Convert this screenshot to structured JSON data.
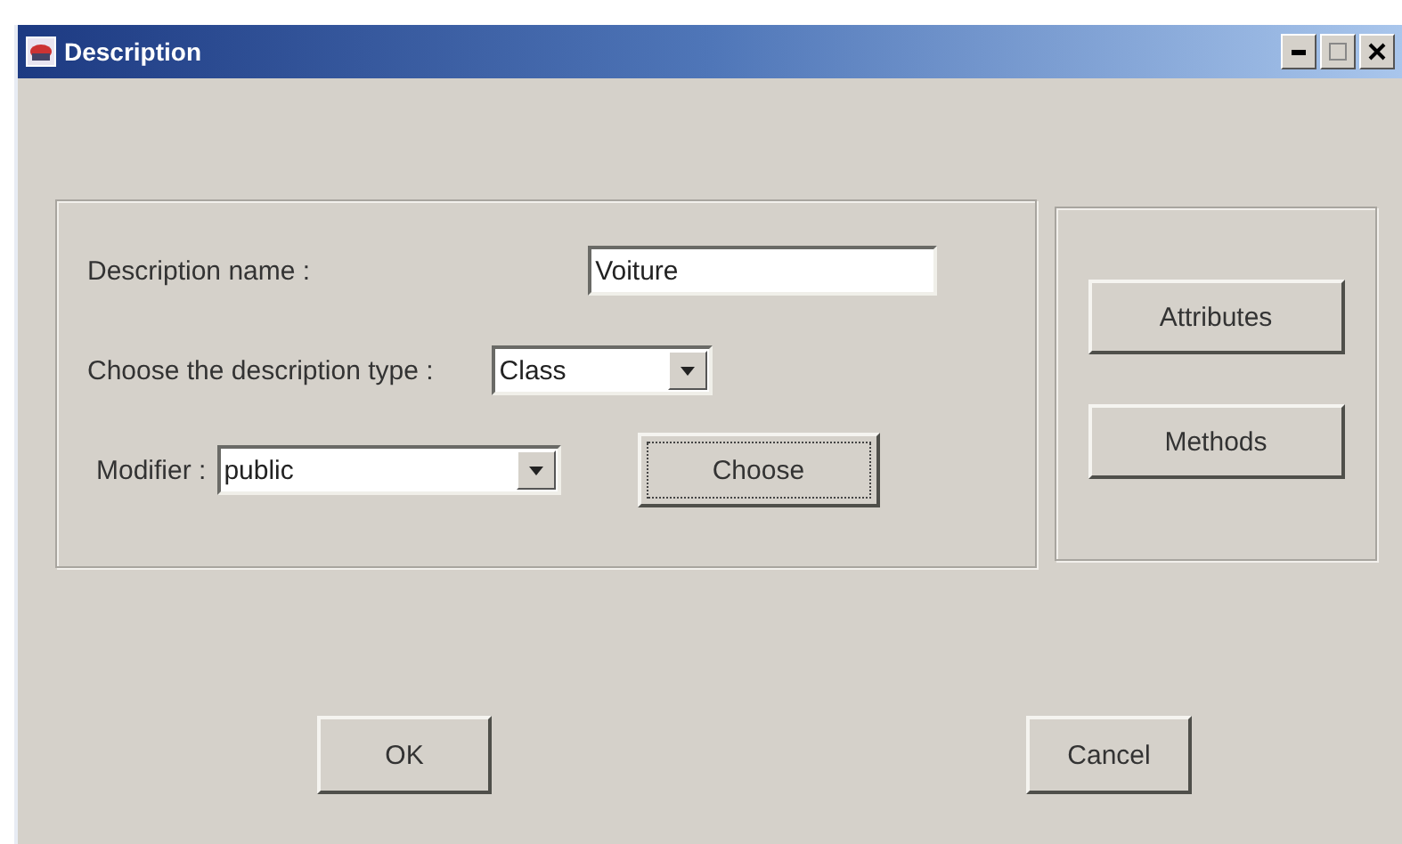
{
  "window": {
    "title": "Description"
  },
  "form": {
    "name_label": "Description name :",
    "name_value": "Voiture",
    "type_label": "Choose the description type :",
    "type_value": "Class",
    "modifier_label": "Modifier :",
    "modifier_value": "public",
    "choose_button": {
      "label": "Choose",
      "focused": true
    }
  },
  "side_buttons": [
    {
      "label": "Attributes",
      "focused": false
    },
    {
      "label": "Methods",
      "focused": false
    }
  ],
  "footer_buttons": [
    {
      "label": "OK",
      "focused": false
    },
    {
      "label": "Cancel",
      "focused": false
    }
  ]
}
